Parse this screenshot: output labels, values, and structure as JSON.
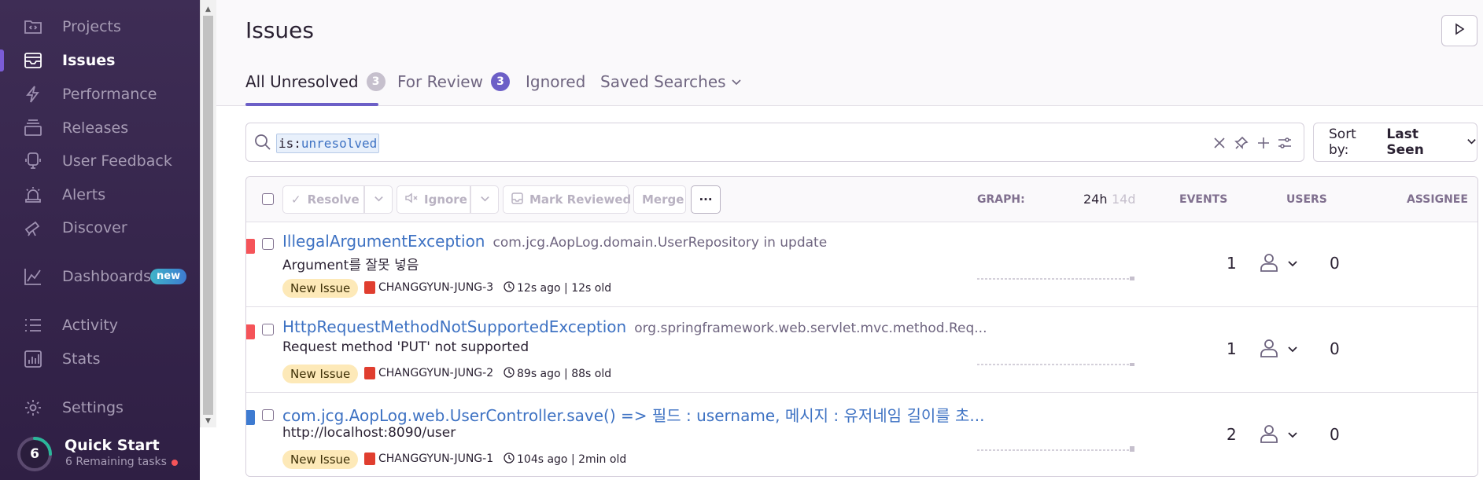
{
  "sidebar": {
    "items": [
      {
        "label": "Projects",
        "icon": "projects-icon"
      },
      {
        "label": "Issues",
        "icon": "issues-icon",
        "active": true
      },
      {
        "label": "Performance",
        "icon": "lightning-icon"
      },
      {
        "label": "Releases",
        "icon": "releases-icon"
      },
      {
        "label": "User Feedback",
        "icon": "feedback-icon"
      },
      {
        "label": "Alerts",
        "icon": "siren-icon"
      },
      {
        "label": "Discover",
        "icon": "telescope-icon"
      },
      {
        "label": "Dashboards",
        "icon": "chart-line-icon",
        "badge": "new"
      },
      {
        "label": "Activity",
        "icon": "list-icon"
      },
      {
        "label": "Stats",
        "icon": "bar-chart-icon"
      },
      {
        "label": "Settings",
        "icon": "gear-icon"
      }
    ],
    "quickstart": {
      "count": "6",
      "title": "Quick Start",
      "subtitle": "6 Remaining tasks",
      "progress": 0.25
    }
  },
  "header": {
    "title": "Issues",
    "tabs": [
      {
        "label": "All Unresolved",
        "count": "3"
      },
      {
        "label": "For Review",
        "count": "3"
      },
      {
        "label": "Ignored"
      },
      {
        "label": "Saved Searches"
      }
    ]
  },
  "search": {
    "key": "is:",
    "value": "unresolved"
  },
  "sort": {
    "label": "Sort by:",
    "value": "Last Seen"
  },
  "toolbar": {
    "resolve": "Resolve",
    "ignore": "Ignore",
    "mark_reviewed": "Mark Reviewed",
    "merge": "Merge",
    "more": "···",
    "graph": "GRAPH:",
    "graph_24h": "24h",
    "graph_14d": "14d",
    "events": "EVENTS",
    "users": "USERS",
    "assignee": "ASSIGNEE"
  },
  "issues": [
    {
      "title": "IllegalArgumentException",
      "culprit": "com.jcg.AopLog.domain.UserRepository in update",
      "message": "Argument를 잘못 넣음",
      "status": "New Issue",
      "short_id": "CHANGGYUN-JUNG-3",
      "time": "12s ago | 12s old",
      "events": "1",
      "users": "0",
      "level_color": "#f55459"
    },
    {
      "title": "HttpRequestMethodNotSupportedException",
      "culprit": "org.springframework.web.servlet.mvc.method.Req...",
      "message": "Request method 'PUT' not supported",
      "status": "New Issue",
      "short_id": "CHANGGYUN-JUNG-2",
      "time": "89s ago | 88s old",
      "events": "1",
      "users": "0",
      "level_color": "#f55459"
    },
    {
      "title": "com.jcg.AopLog.web.UserController.save() => 필드 : username, 메시지 : 유저네임 길이를 초...",
      "culprit": "",
      "message": "http://localhost:8090/user",
      "status": "New Issue",
      "short_id": "CHANGGYUN-JUNG-1",
      "time": "104s ago | 2min old",
      "events": "2",
      "users": "0",
      "level_color": "#3e7bd1"
    }
  ]
}
